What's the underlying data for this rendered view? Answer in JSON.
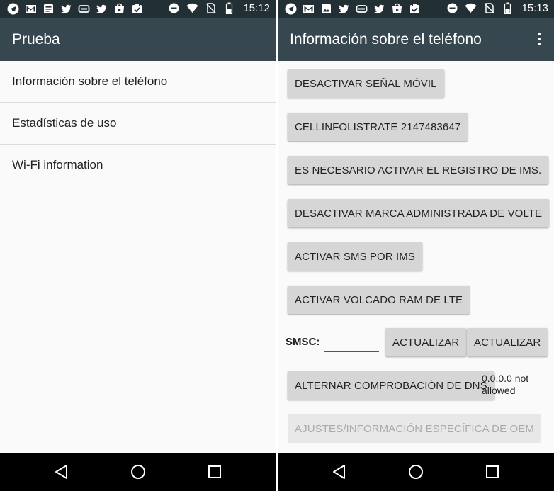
{
  "left": {
    "status": {
      "time": "15:12"
    },
    "appbar": {
      "title": "Prueba"
    },
    "items": [
      {
        "label": "Información sobre el teléfono"
      },
      {
        "label": "Estadísticas de uso"
      },
      {
        "label": "Wi-Fi information"
      }
    ]
  },
  "right": {
    "status": {
      "time": "15:13"
    },
    "appbar": {
      "title": "Información sobre el teléfono"
    },
    "buttons": {
      "disable_radio": "DESACTIVAR SEÑAL MÓVIL",
      "cellinfo": "CELLINFOLISTRATE 2147483647",
      "ims_reg": "ES NECESARIO ACTIVAR EL REGISTRO DE IMS.",
      "volte": "DESACTIVAR MARCA ADMINISTRADA DE VOLTE",
      "sms_ims": "ACTIVAR SMS POR IMS",
      "lte_ram": "ACTIVAR VOLCADO RAM DE LTE",
      "update1": "ACTUALIZAR",
      "update2": "ACTUALIZAR",
      "dns_toggle": "ALTERNAR COMPROBACIÓN DE DNS",
      "oem": "AJUSTES/INFORMACIÓN ESPECÍFICA DE OEM"
    },
    "smsc": {
      "label": "SMSC:",
      "value": ""
    },
    "dns_status": "0.0.0.0 not allowed"
  },
  "icons": {
    "status_left": [
      "telegram-icon",
      "gmail-icon",
      "news-icon",
      "twitter-icon",
      "rcs-icon",
      "twitter-icon",
      "store-icon",
      "tasks-icon"
    ],
    "status_right": [
      "do-not-disturb-icon",
      "wifi-icon",
      "no-sim-icon",
      "battery-icon"
    ],
    "nav": [
      "back-icon",
      "home-icon",
      "recents-icon"
    ]
  },
  "colors": {
    "statusbar": "#222f35",
    "appbar": "#37474f",
    "button": "#d6d6d6",
    "navbar": "#000000"
  }
}
